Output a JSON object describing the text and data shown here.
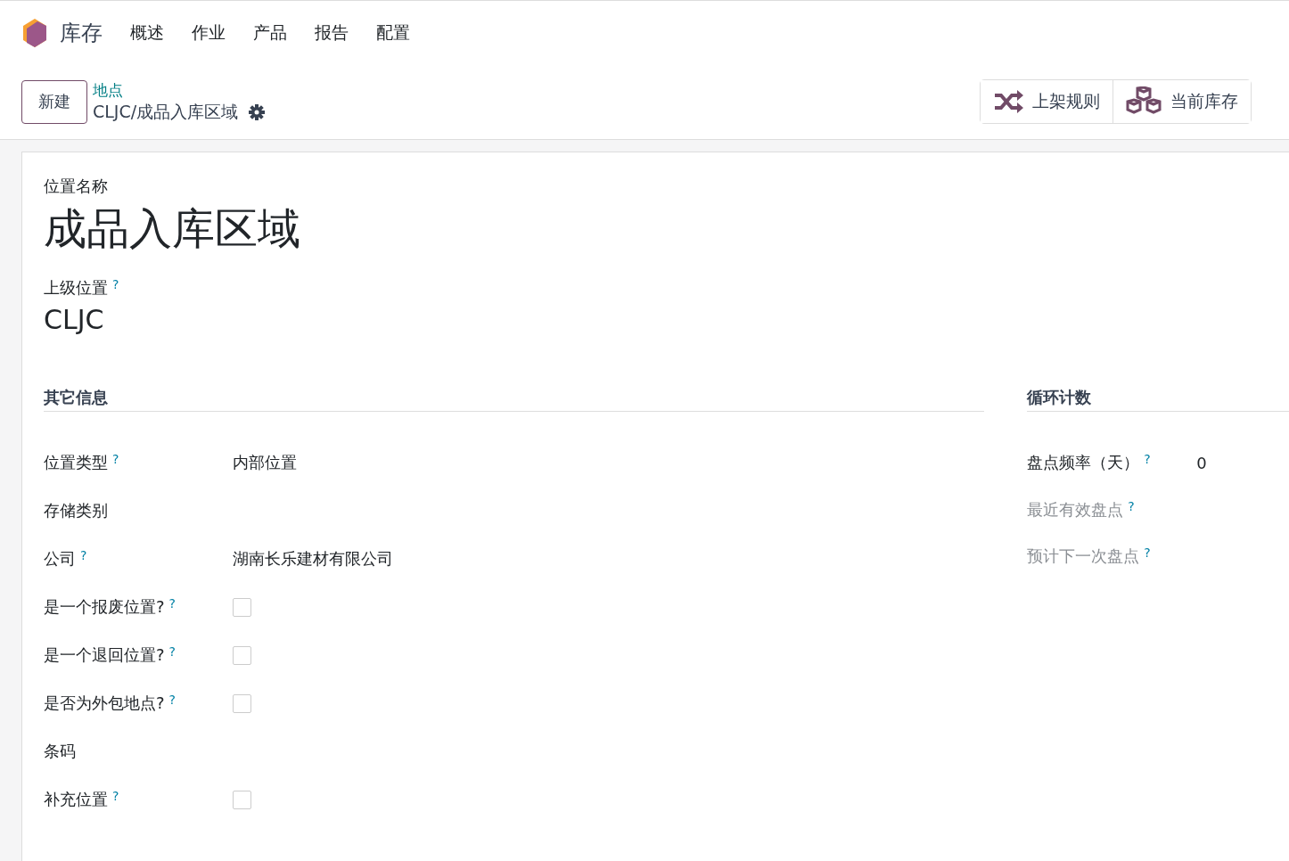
{
  "app": {
    "name": "库存",
    "menu": [
      "概述",
      "作业",
      "产品",
      "报告",
      "配置"
    ]
  },
  "control": {
    "new_button": "新建",
    "breadcrumb": "地点",
    "record": "CLJC/成品入库区域",
    "buttons": [
      {
        "label": "上架规则",
        "kind": "shuffle"
      },
      {
        "label": "当前库存",
        "kind": "boxes"
      }
    ]
  },
  "form": {
    "name_label": "位置名称",
    "name": "成品入库区域",
    "parent_label": "上级位置",
    "parent_help": "?",
    "parent": "CLJC",
    "left": {
      "title": "其它信息",
      "fields": [
        {
          "kind": "text",
          "label": "位置类型",
          "help": "?",
          "value": "内部位置"
        },
        {
          "kind": "empty",
          "label": "存储类别"
        },
        {
          "kind": "text",
          "label": "公司",
          "help": "?",
          "value": "湖南长乐建材有限公司"
        },
        {
          "kind": "checkbox",
          "label": "是一个报废位置?",
          "help": "?",
          "checked": false
        },
        {
          "kind": "checkbox",
          "label": "是一个退回位置?",
          "help": "?",
          "checked": false
        },
        {
          "kind": "checkbox",
          "label": "是否为外包地点?",
          "help": "?",
          "checked": false
        },
        {
          "kind": "empty",
          "label": "条码"
        },
        {
          "kind": "checkbox",
          "label": "补充位置",
          "help": "?",
          "checked": false
        }
      ]
    },
    "right": {
      "title": "循环计数",
      "fields": [
        {
          "label": "盘点频率（天）",
          "help": "?",
          "value": "0",
          "disabled": false
        },
        {
          "label": "最近有效盘点",
          "help": "?",
          "disabled": true
        },
        {
          "label": "预计下一次盘点",
          "help": "?",
          "disabled": true
        }
      ]
    }
  }
}
